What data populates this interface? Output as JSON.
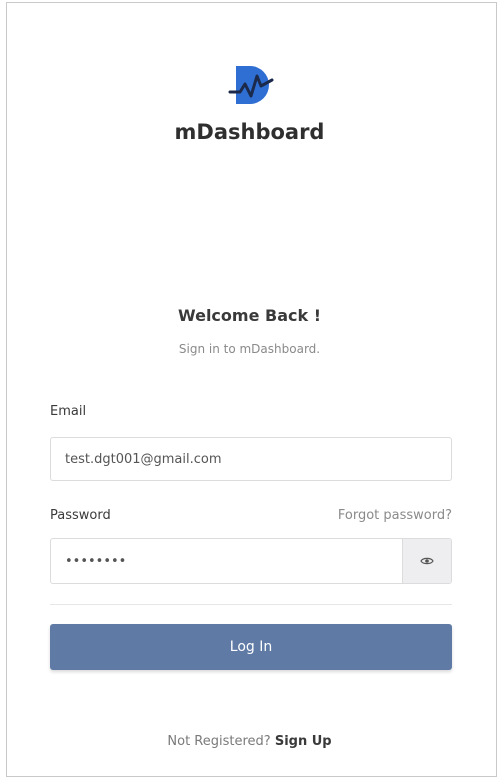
{
  "brand": {
    "name": "mDashboard",
    "logo_color": "#2f6fd3",
    "logo_stroke": "#1b2a4a"
  },
  "header": {
    "title": "Welcome Back !",
    "subtitle": "Sign in to mDashboard."
  },
  "form": {
    "email": {
      "label": "Email",
      "value": "test.dgt001@gmail.com"
    },
    "password": {
      "label": "Password",
      "value": "password",
      "forgot_label": "Forgot password?"
    },
    "submit_label": "Log In"
  },
  "footer": {
    "question": "Not Registered?",
    "signup_label": "Sign Up"
  },
  "colors": {
    "primary_button": "#5e7aa5",
    "eye_button_bg": "#eeeef1"
  },
  "icons": {
    "logo": "brand-logo-icon",
    "eye": "eye-icon"
  }
}
